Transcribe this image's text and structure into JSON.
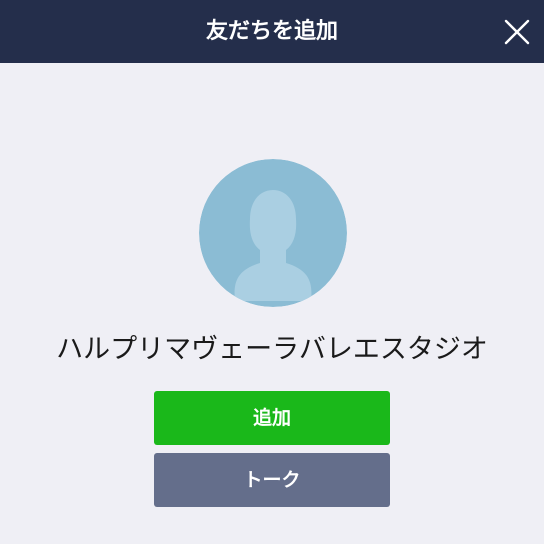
{
  "header": {
    "title": "友だちを追加",
    "close_icon": "close-icon"
  },
  "profile": {
    "avatar_icon": "default-user-avatar-icon",
    "name": "ハルプリマヴェーラバレエスタジオ"
  },
  "actions": {
    "add_label": "追加",
    "talk_label": "トーク"
  },
  "colors": {
    "header_bg": "#242e4b",
    "page_bg": "#efeff5",
    "add_button": "#1ab81a",
    "talk_button": "#646e8b",
    "avatar_bg": "#8bbcd4",
    "avatar_silhouette": "#aacfe2"
  }
}
